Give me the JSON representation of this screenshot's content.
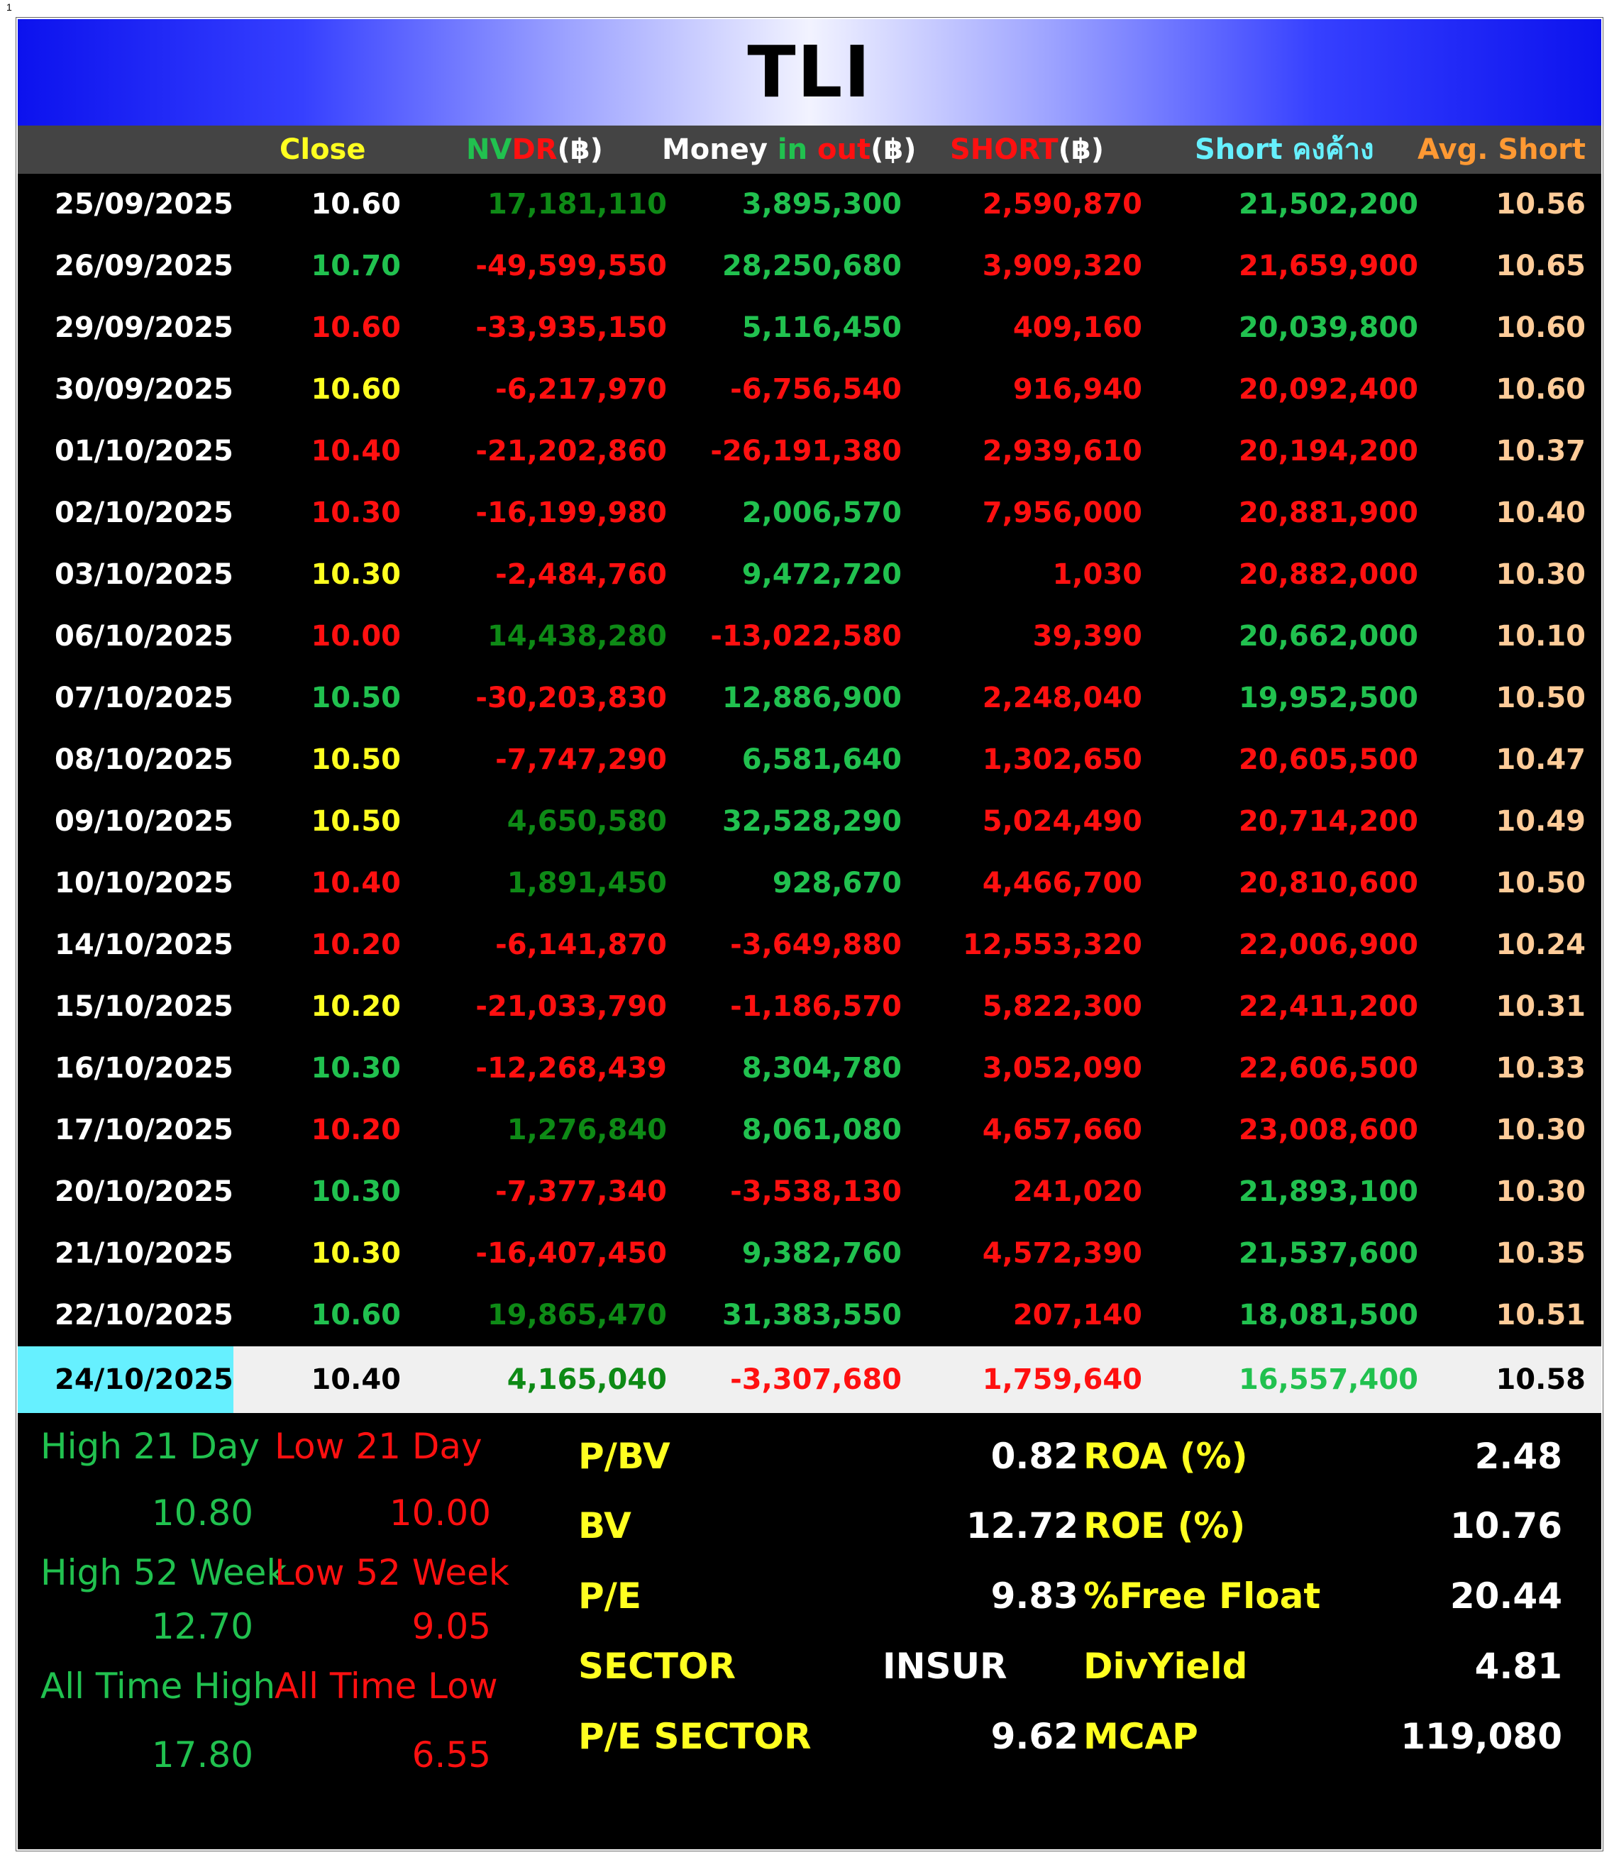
{
  "page_marker": "1",
  "title": "TLI",
  "colors": {
    "banner_edge": "#0c12ee",
    "banner_center": "#f2f3ff",
    "header_bg": "#444444",
    "table_bg": "#000000",
    "green": "#21c14f",
    "dark_green": "#0e8a16",
    "red": "#ff1010",
    "yellow": "#ffff20",
    "cyan": "#66f0ff",
    "orange": "#ff9933",
    "peach": "#ffcc99"
  },
  "header": {
    "close": "Close",
    "nvdr_a": "NV",
    "nvdr_b": "DR",
    "nvdr_c": "(฿)",
    "money_a": "Money ",
    "money_b": "in ",
    "money_c": "out",
    "money_d": "(฿)",
    "short_a": "SHORT",
    "short_b": "(฿)",
    "short_outstanding": "Short คงค้าง",
    "avg_short": "Avg. Short"
  },
  "rows": [
    {
      "date": "25/09/2025",
      "close": "10.60",
      "close_c": "#ffffff",
      "nvdr": "17,181,110",
      "nvdr_c": "#0e8a16",
      "money": "3,895,300",
      "money_c": "#21c14f",
      "short": "2,590,870",
      "short_c": "#ff1010",
      "outstanding": "21,502,200",
      "out_c": "#21c14f",
      "avg": "10.56"
    },
    {
      "date": "26/09/2025",
      "close": "10.70",
      "close_c": "#21c14f",
      "nvdr": "-49,599,550",
      "nvdr_c": "#ff1010",
      "money": "28,250,680",
      "money_c": "#21c14f",
      "short": "3,909,320",
      "short_c": "#ff1010",
      "outstanding": "21,659,900",
      "out_c": "#ff1010",
      "avg": "10.65"
    },
    {
      "date": "29/09/2025",
      "close": "10.60",
      "close_c": "#ff1010",
      "nvdr": "-33,935,150",
      "nvdr_c": "#ff1010",
      "money": "5,116,450",
      "money_c": "#21c14f",
      "short": "409,160",
      "short_c": "#ff1010",
      "outstanding": "20,039,800",
      "out_c": "#21c14f",
      "avg": "10.60"
    },
    {
      "date": "30/09/2025",
      "close": "10.60",
      "close_c": "#ffff20",
      "nvdr": "-6,217,970",
      "nvdr_c": "#ff1010",
      "money": "-6,756,540",
      "money_c": "#ff1010",
      "short": "916,940",
      "short_c": "#ff1010",
      "outstanding": "20,092,400",
      "out_c": "#ff1010",
      "avg": "10.60"
    },
    {
      "date": "01/10/2025",
      "close": "10.40",
      "close_c": "#ff1010",
      "nvdr": "-21,202,860",
      "nvdr_c": "#ff1010",
      "money": "-26,191,380",
      "money_c": "#ff1010",
      "short": "2,939,610",
      "short_c": "#ff1010",
      "outstanding": "20,194,200",
      "out_c": "#ff1010",
      "avg": "10.37"
    },
    {
      "date": "02/10/2025",
      "close": "10.30",
      "close_c": "#ff1010",
      "nvdr": "-16,199,980",
      "nvdr_c": "#ff1010",
      "money": "2,006,570",
      "money_c": "#21c14f",
      "short": "7,956,000",
      "short_c": "#ff1010",
      "outstanding": "20,881,900",
      "out_c": "#ff1010",
      "avg": "10.40"
    },
    {
      "date": "03/10/2025",
      "close": "10.30",
      "close_c": "#ffff20",
      "nvdr": "-2,484,760",
      "nvdr_c": "#ff1010",
      "money": "9,472,720",
      "money_c": "#21c14f",
      "short": "1,030",
      "short_c": "#ff1010",
      "outstanding": "20,882,000",
      "out_c": "#ff1010",
      "avg": "10.30"
    },
    {
      "date": "06/10/2025",
      "close": "10.00",
      "close_c": "#ff1010",
      "nvdr": "14,438,280",
      "nvdr_c": "#0e8a16",
      "money": "-13,022,580",
      "money_c": "#ff1010",
      "short": "39,390",
      "short_c": "#ff1010",
      "outstanding": "20,662,000",
      "out_c": "#21c14f",
      "avg": "10.10"
    },
    {
      "date": "07/10/2025",
      "close": "10.50",
      "close_c": "#21c14f",
      "nvdr": "-30,203,830",
      "nvdr_c": "#ff1010",
      "money": "12,886,900",
      "money_c": "#21c14f",
      "short": "2,248,040",
      "short_c": "#ff1010",
      "outstanding": "19,952,500",
      "out_c": "#21c14f",
      "avg": "10.50"
    },
    {
      "date": "08/10/2025",
      "close": "10.50",
      "close_c": "#ffff20",
      "nvdr": "-7,747,290",
      "nvdr_c": "#ff1010",
      "money": "6,581,640",
      "money_c": "#21c14f",
      "short": "1,302,650",
      "short_c": "#ff1010",
      "outstanding": "20,605,500",
      "out_c": "#ff1010",
      "avg": "10.47"
    },
    {
      "date": "09/10/2025",
      "close": "10.50",
      "close_c": "#ffff20",
      "nvdr": "4,650,580",
      "nvdr_c": "#0e8a16",
      "money": "32,528,290",
      "money_c": "#21c14f",
      "short": "5,024,490",
      "short_c": "#ff1010",
      "outstanding": "20,714,200",
      "out_c": "#ff1010",
      "avg": "10.49"
    },
    {
      "date": "10/10/2025",
      "close": "10.40",
      "close_c": "#ff1010",
      "nvdr": "1,891,450",
      "nvdr_c": "#0e8a16",
      "money": "928,670",
      "money_c": "#21c14f",
      "short": "4,466,700",
      "short_c": "#ff1010",
      "outstanding": "20,810,600",
      "out_c": "#ff1010",
      "avg": "10.50"
    },
    {
      "date": "14/10/2025",
      "close": "10.20",
      "close_c": "#ff1010",
      "nvdr": "-6,141,870",
      "nvdr_c": "#ff1010",
      "money": "-3,649,880",
      "money_c": "#ff1010",
      "short": "12,553,320",
      "short_c": "#ff1010",
      "outstanding": "22,006,900",
      "out_c": "#ff1010",
      "avg": "10.24"
    },
    {
      "date": "15/10/2025",
      "close": "10.20",
      "close_c": "#ffff20",
      "nvdr": "-21,033,790",
      "nvdr_c": "#ff1010",
      "money": "-1,186,570",
      "money_c": "#ff1010",
      "short": "5,822,300",
      "short_c": "#ff1010",
      "outstanding": "22,411,200",
      "out_c": "#ff1010",
      "avg": "10.31"
    },
    {
      "date": "16/10/2025",
      "close": "10.30",
      "close_c": "#21c14f",
      "nvdr": "-12,268,439",
      "nvdr_c": "#ff1010",
      "money": "8,304,780",
      "money_c": "#21c14f",
      "short": "3,052,090",
      "short_c": "#ff1010",
      "outstanding": "22,606,500",
      "out_c": "#ff1010",
      "avg": "10.33"
    },
    {
      "date": "17/10/2025",
      "close": "10.20",
      "close_c": "#ff1010",
      "nvdr": "1,276,840",
      "nvdr_c": "#0e8a16",
      "money": "8,061,080",
      "money_c": "#21c14f",
      "short": "4,657,660",
      "short_c": "#ff1010",
      "outstanding": "23,008,600",
      "out_c": "#ff1010",
      "avg": "10.30"
    },
    {
      "date": "20/10/2025",
      "close": "10.30",
      "close_c": "#21c14f",
      "nvdr": "-7,377,340",
      "nvdr_c": "#ff1010",
      "money": "-3,538,130",
      "money_c": "#ff1010",
      "short": "241,020",
      "short_c": "#ff1010",
      "outstanding": "21,893,100",
      "out_c": "#21c14f",
      "avg": "10.30"
    },
    {
      "date": "21/10/2025",
      "close": "10.30",
      "close_c": "#ffff20",
      "nvdr": "-16,407,450",
      "nvdr_c": "#ff1010",
      "money": "9,382,760",
      "money_c": "#21c14f",
      "short": "4,572,390",
      "short_c": "#ff1010",
      "outstanding": "21,537,600",
      "out_c": "#21c14f",
      "avg": "10.35"
    },
    {
      "date": "22/10/2025",
      "close": "10.60",
      "close_c": "#21c14f",
      "nvdr": "19,865,470",
      "nvdr_c": "#0e8a16",
      "money": "31,383,550",
      "money_c": "#21c14f",
      "short": "207,140",
      "short_c": "#ff1010",
      "outstanding": "18,081,500",
      "out_c": "#21c14f",
      "avg": "10.51"
    }
  ],
  "last_row": {
    "date": "24/10/2025",
    "close": "10.40",
    "nvdr": "4,165,040",
    "money": "-3,307,680",
    "short": "1,759,640",
    "outstanding": "16,557,400",
    "avg": "10.58"
  },
  "stats": {
    "high21_label": "High 21 Day",
    "low21_label": "Low 21 Day",
    "high21": "10.80",
    "low21": "10.00",
    "high52_label": "High 52 Week",
    "low52_label": "Low 52 Week",
    "high52": "12.70",
    "low52": "9.05",
    "ath_label": "All Time High",
    "atl_label": "All Time Low",
    "ath": "17.80",
    "atl": "6.55"
  },
  "metrics": {
    "pbv_label": "P/BV",
    "pbv": "0.82",
    "roa_label": "ROA (%)",
    "roa": "2.48",
    "bv_label": "BV",
    "bv": "12.72",
    "roe_label": "ROE (%)",
    "roe": "10.76",
    "pe_label": "P/E",
    "pe": "9.83",
    "float_label": "%Free Float",
    "float": "20.44",
    "sector_label": "SECTOR",
    "sector": "INSUR",
    "div_label": "DivYield",
    "div": "4.81",
    "pes_label": "P/E SECTOR",
    "pes": "9.62",
    "mcap_label": "MCAP",
    "mcap": "119,080"
  }
}
